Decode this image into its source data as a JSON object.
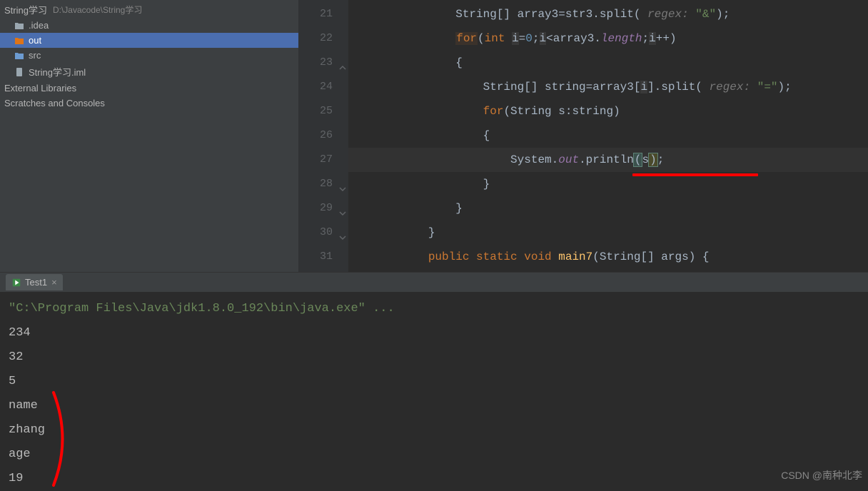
{
  "projectTree": {
    "rootName": "String学习",
    "rootPath": "D:\\Javacode\\String学习",
    "items": [
      {
        "name": ".idea",
        "type": "folder",
        "indent": 1
      },
      {
        "name": "out",
        "type": "folder-orange",
        "indent": 1,
        "selected": true
      },
      {
        "name": "src",
        "type": "folder-blue",
        "indent": 1
      },
      {
        "name": "String学习.iml",
        "type": "file",
        "indent": 1
      }
    ],
    "externalLibraries": "External Libraries",
    "scratches": "Scratches and Consoles"
  },
  "editor": {
    "lines": [
      {
        "num": 21,
        "html": "            String[] array3=str3.split("
      },
      {
        "num": 22,
        "html": "            for(int i=0;i<array3.length;i++)"
      },
      {
        "num": 23,
        "html": "            {"
      },
      {
        "num": 24,
        "html": "                String[] string=array3[i].split("
      },
      {
        "num": 25,
        "html": "                for(String s:string)"
      },
      {
        "num": 26,
        "html": "                {"
      },
      {
        "num": 27,
        "html": "                    System.out.println(s);",
        "current": true,
        "bulb": true
      },
      {
        "num": 28,
        "html": "                }"
      },
      {
        "num": 29,
        "html": "            }"
      },
      {
        "num": 30,
        "html": "        }"
      },
      {
        "num": 31,
        "html": "        public static void main7(String[] args) {"
      }
    ],
    "regex_hint": "regex:",
    "str_amp": "\"&\"",
    "str_eq": "\"=\""
  },
  "runPanel": {
    "tabName": "Test1",
    "javaCmd": "\"C:\\Program Files\\Java\\jdk1.8.0_192\\bin\\java.exe\" ...",
    "output": [
      "234",
      "32",
      "5",
      "name",
      "zhang",
      "age",
      "19"
    ]
  },
  "watermark": "CSDN @南种北李"
}
